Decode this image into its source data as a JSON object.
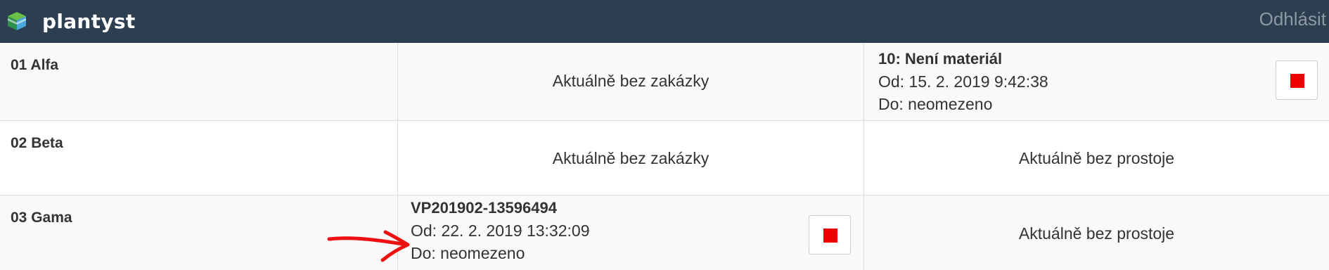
{
  "navbar": {
    "brand": "plantyst",
    "logout_label": "Odhlásit",
    "background": "#2c3e50"
  },
  "rows": [
    {
      "name": "01 Alfa",
      "order": {
        "status_text": "Aktuálně bez zakázky"
      },
      "downtime": {
        "title": "10: Není materiál",
        "from": "Od: 15. 2. 2019 9:42:38",
        "to": "Do: neomezeno",
        "stop_icon": "stop-icon"
      }
    },
    {
      "name": "02 Beta",
      "order": {
        "status_text": "Aktuálně bez zakázky"
      },
      "downtime": {
        "status_text": "Aktuálně bez prostoje"
      }
    },
    {
      "name": "03 Gama",
      "order": {
        "title": "VP201902-13596494",
        "from": "Od: 22. 2. 2019 13:32:09",
        "to": "Do: neomezeno",
        "stop_icon": "stop-icon"
      },
      "downtime": {
        "status_text": "Aktuálně bez prostoje"
      }
    }
  ],
  "colors": {
    "stop_red": "#ee0000",
    "annotation_arrow": "#ee1111"
  }
}
